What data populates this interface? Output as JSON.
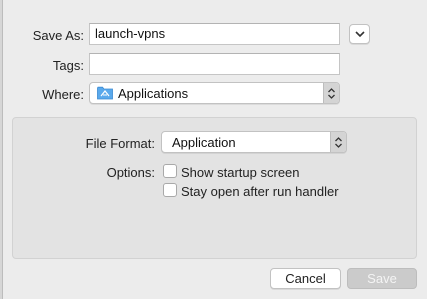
{
  "dialog": {
    "save_as_label": "Save As:",
    "save_as_value": "launch-vpns",
    "tags_label": "Tags:",
    "tags_value": "",
    "where_label": "Where:",
    "where_value": "Applications",
    "where_icon": "applications-folder-icon"
  },
  "options": {
    "file_format_label": "File Format:",
    "file_format_value": "Application",
    "options_label": "Options:",
    "checkboxes": [
      {
        "label": "Show startup screen",
        "checked": false
      },
      {
        "label": "Stay open after run handler",
        "checked": false
      }
    ]
  },
  "buttons": {
    "cancel_label": "Cancel",
    "save_label": "Save",
    "save_enabled": false
  },
  "colors": {
    "folder_blue": "#5aa9ec",
    "dialog_bg": "#ececec",
    "options_bg": "#e3e3e3"
  }
}
